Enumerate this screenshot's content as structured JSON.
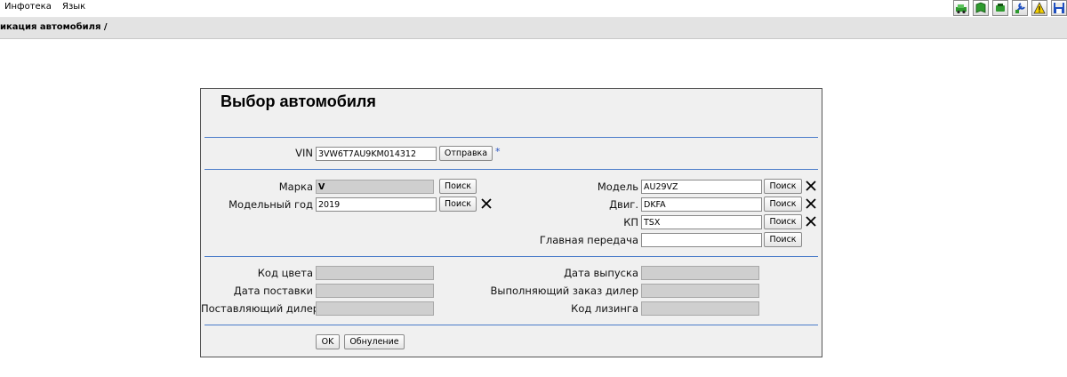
{
  "menu": {
    "items": [
      "Инфотека",
      "Язык"
    ]
  },
  "toolbar": {
    "icons": [
      "car-tool-icon",
      "book-icon",
      "engine-icon",
      "wrench-icon",
      "warning-icon",
      "save-icon"
    ],
    "colors": {
      "green": "#2e9a2e",
      "warning": "#f4d000",
      "save": "#1f4fbf"
    }
  },
  "breadcrumb": {
    "text": "икация автомобиля /"
  },
  "panel": {
    "title": "Выбор автомобиля"
  },
  "vin": {
    "label": "VIN",
    "value": "3VW6T7AU9KM014312",
    "submit_label": "Отправка",
    "required_mark": "*"
  },
  "vehicle": {
    "brand": {
      "label": "Марка",
      "value": "V",
      "search_label": "Поиск"
    },
    "model_year": {
      "label": "Модельный год",
      "value": "2019",
      "search_label": "Поиск"
    },
    "model": {
      "label": "Модель",
      "value": "AU29VZ",
      "search_label": "Поиск"
    },
    "engine": {
      "label": "Двиг.",
      "value": "DKFA",
      "search_label": "Поиск"
    },
    "gearbox": {
      "label": "КП",
      "value": "TSX",
      "search_label": "Поиск"
    },
    "final_drive": {
      "label": "Главная передача",
      "value": "",
      "search_label": "Поиск"
    }
  },
  "details": {
    "color_code": {
      "label": "Код цвета",
      "value": ""
    },
    "delivery_date": {
      "label": "Дата поставки",
      "value": ""
    },
    "supplying_dealer": {
      "label": "Поставляющий дилер",
      "value": ""
    },
    "production_date": {
      "label": "Дата выпуска",
      "value": ""
    },
    "order_dealer": {
      "label": "Выполняющий заказ дилер",
      "value": ""
    },
    "leasing_code": {
      "label": "Код лизинга",
      "value": ""
    }
  },
  "actions": {
    "ok_label": "OK",
    "reset_label": "Обнуление"
  },
  "colors": {
    "separator": "#4a7cc9",
    "panel_bg": "#f0f0f0",
    "readonly_bg": "#cfcfcf",
    "breadcrumb_bg": "#e3e3e3"
  }
}
